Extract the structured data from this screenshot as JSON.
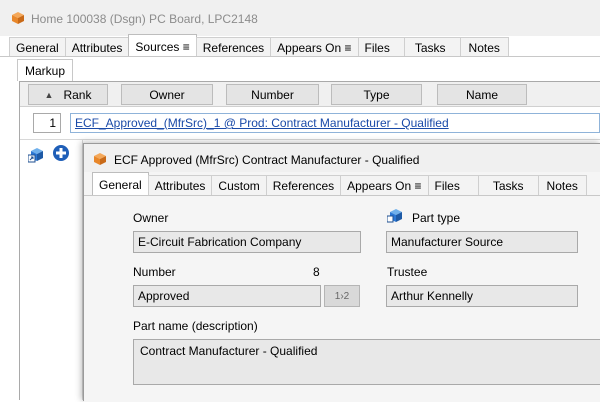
{
  "window": {
    "title": "Home 100038 (Dsgn) PC Board, LPC2148",
    "tabs": [
      {
        "label": "General"
      },
      {
        "label": "Attributes"
      },
      {
        "label": "Sources ≡"
      },
      {
        "label": "References"
      },
      {
        "label": "Appears On ≡"
      },
      {
        "label": "Files"
      },
      {
        "label": "Tasks"
      },
      {
        "label": "Notes"
      }
    ],
    "active_tab": "Sources ≡"
  },
  "sources": {
    "subtab": "Markup",
    "columns": [
      "Rank",
      "Owner",
      "Number",
      "Type",
      "Name"
    ],
    "rows": [
      {
        "rank": "1",
        "link": "ECF_Approved_(MfrSrc)_1 @ Prod: Contract Manufacturer - Qualified"
      }
    ]
  },
  "dialog": {
    "title": "ECF Approved (MfrSrc) Contract Manufacturer - Qualified",
    "tabs": [
      {
        "label": "General"
      },
      {
        "label": "Attributes"
      },
      {
        "label": "Custom"
      },
      {
        "label": "References"
      },
      {
        "label": "Appears On ≡"
      },
      {
        "label": "Files"
      },
      {
        "label": "Tasks"
      },
      {
        "label": "Notes"
      }
    ],
    "active_tab": "General",
    "fields": {
      "owner_label": "Owner",
      "owner_value": "E-Circuit Fabrication Company",
      "part_type_label": "Part type",
      "part_type_value": "Manufacturer Source",
      "number_label": "Number",
      "number_counter": "8",
      "number_value": "Approved",
      "generate_label": "1›2",
      "trustee_label": "Trustee",
      "trustee_value": "Arthur Kennelly",
      "part_name_label": "Part name (description)",
      "part_name_value": "Contract Manufacturer - Qualified"
    }
  },
  "colors": {
    "box_icon": "#e8872a",
    "link": "#1a4aa8",
    "part_type_icon": "#2b78d6"
  }
}
